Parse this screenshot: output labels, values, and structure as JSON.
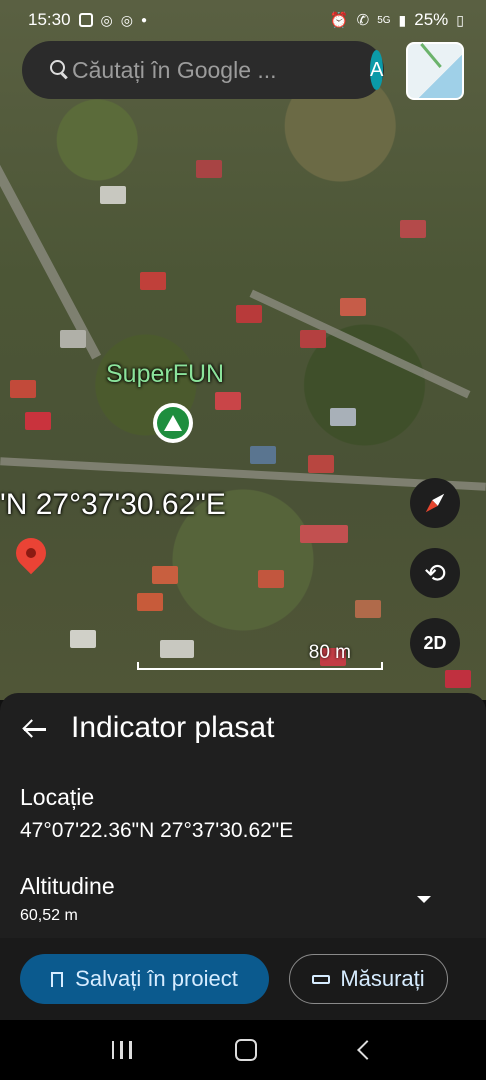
{
  "status_bar": {
    "time": "15:30",
    "network": "5G",
    "battery": "25%"
  },
  "search": {
    "placeholder": "Căutați în Google ...",
    "avatar_letter": "A"
  },
  "map": {
    "poi_label": "SuperFUN",
    "coordinate_overlay": "'N 27°37'30.62\"E",
    "scale_label": "80 m",
    "view_mode_button": "2D"
  },
  "sheet": {
    "title": "Indicator plasat",
    "location_label": "Locație",
    "location_value": "47°07'22.36\"N 27°37'30.62\"E",
    "altitude_label": "Altitudine",
    "altitude_value": "60,52 m"
  },
  "actions": {
    "save_label": "Salvați în proiect",
    "measure_label": "Măsurați"
  },
  "colors": {
    "accent": "#0b5a8e",
    "poi_green": "#1e8e3e",
    "pin_red": "#ea4335"
  }
}
